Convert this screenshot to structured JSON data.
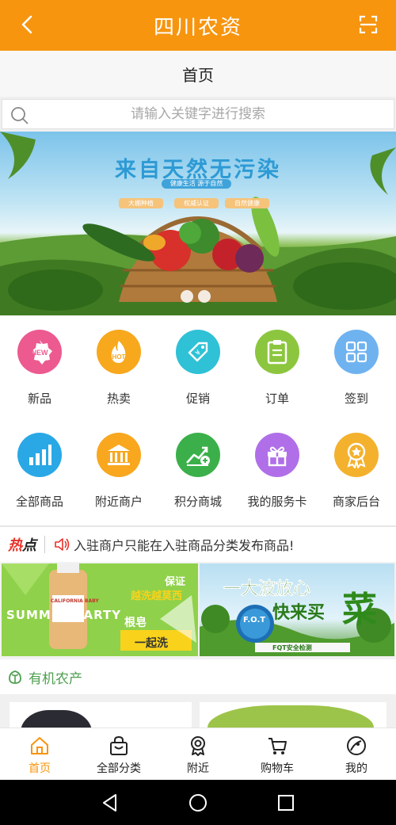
{
  "header": {
    "title": "四川农资",
    "back_icon": "chevron-left-icon",
    "scan_icon": "scan-icon"
  },
  "page": {
    "title": "首页"
  },
  "search": {
    "placeholder": "请输入关键字进行搜索",
    "icon": "search-icon"
  },
  "banner": {
    "headline": "来自天然无污染",
    "subtitle": "健康生活 源于自然",
    "tags": [
      "大棚种植",
      "权威认证",
      "自然健康"
    ],
    "dots": 2,
    "active_dot": 0
  },
  "grid": {
    "items": [
      {
        "label": "新品",
        "icon": "new-badge-icon",
        "color": "#ec5a8f"
      },
      {
        "label": "热卖",
        "icon": "hot-fire-icon",
        "color": "#f7a81d"
      },
      {
        "label": "促销",
        "icon": "tag-icon",
        "color": "#2fc1d6"
      },
      {
        "label": "订单",
        "icon": "clipboard-icon",
        "color": "#8cc63f"
      },
      {
        "label": "签到",
        "icon": "grid-icon",
        "color": "#6fb2f0"
      },
      {
        "label": "全部商品",
        "icon": "bar-chart-icon",
        "color": "#2aa8e6"
      },
      {
        "label": "附近商户",
        "icon": "bank-icon",
        "color": "#f8a71f"
      },
      {
        "label": "积分商城",
        "icon": "trend-plus-icon",
        "color": "#3bb04a"
      },
      {
        "label": "我的服务卡",
        "icon": "gift-icon",
        "color": "#b06fe8"
      },
      {
        "label": "商家后台",
        "icon": "medal-icon",
        "color": "#f4b12e"
      }
    ]
  },
  "hot": {
    "logo_red": "热",
    "logo_dark": "点",
    "message": "入驻商户只能在入驻商品分类发布商品!"
  },
  "promos": {
    "left": {
      "line1": "保证",
      "line2": "越洗越莫西",
      "line3": "SUMMER PARTY",
      "line4": "根皂",
      "line5": "一起洗",
      "brand": "CALIFORNIA BABY"
    },
    "right": {
      "line1": "一大波放心",
      "line2": "快来买",
      "line3": "菜",
      "badge": "F.O.T",
      "footer": "FQT安全检测"
    }
  },
  "section": {
    "title": "有机农产",
    "icon": "leaf-icon"
  },
  "tabbar": {
    "items": [
      {
        "label": "首页",
        "icon": "home-icon",
        "active": true
      },
      {
        "label": "全部分类",
        "icon": "bag-icon",
        "active": false
      },
      {
        "label": "附近",
        "icon": "badge-ribbon-icon",
        "active": false
      },
      {
        "label": "购物车",
        "icon": "cart-icon",
        "active": false
      },
      {
        "label": "我的",
        "icon": "profile-icon",
        "active": false
      }
    ]
  },
  "colors": {
    "brand": "#f7950f",
    "section_green": "#4e9f4f",
    "hot_red": "#e8332a"
  }
}
